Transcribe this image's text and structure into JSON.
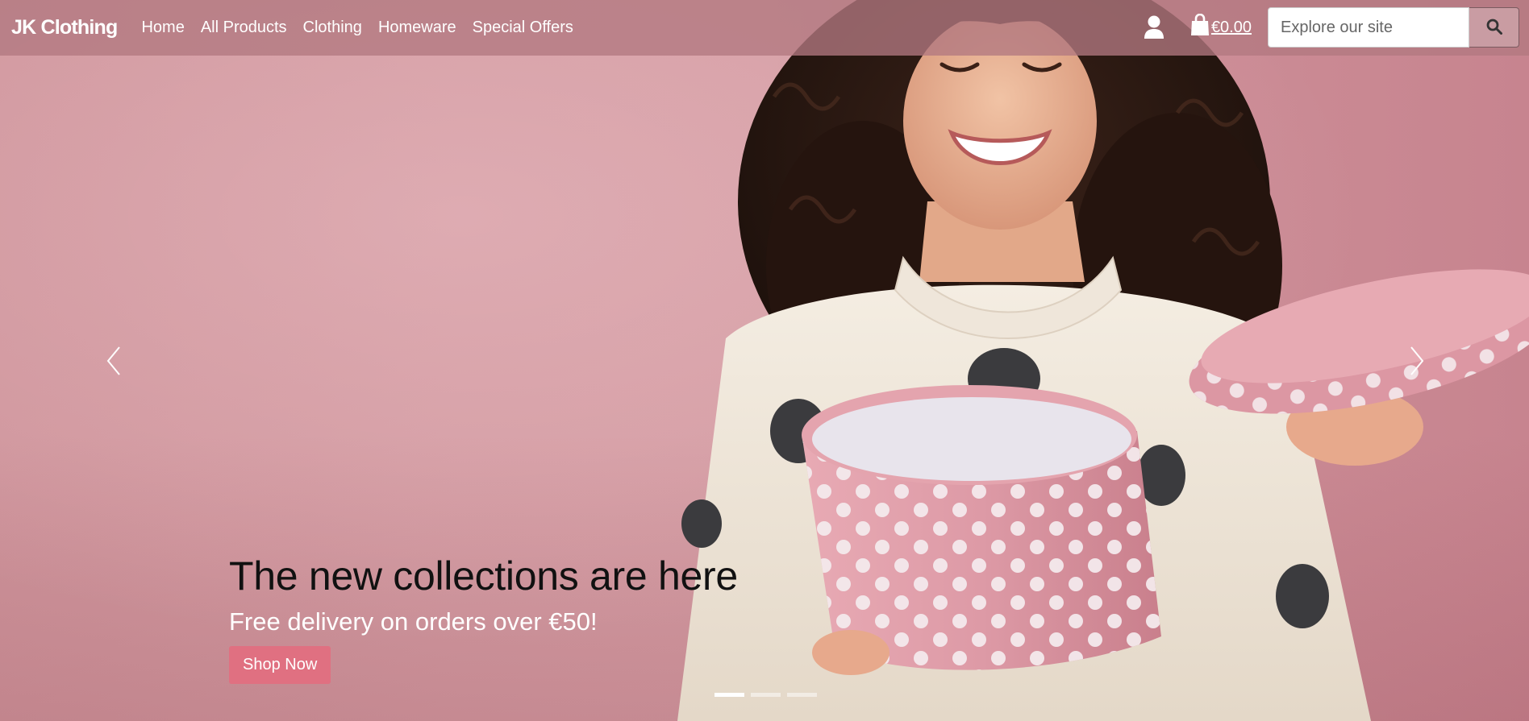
{
  "navbar": {
    "brand": "JK Clothing",
    "links": [
      "Home",
      "All Products",
      "Clothing",
      "Homeware",
      "Special Offers"
    ],
    "cart_total": "€0.00",
    "search_placeholder": "Explore our site"
  },
  "hero": {
    "heading": "The new collections are here",
    "subheading": "Free delivery on orders over €50!",
    "cta_label": "Shop Now",
    "slide_count": 3,
    "active_slide": 1
  },
  "colors": {
    "navbar_bg": "#b27880",
    "hero_bg": "#d49ca3",
    "cta_bg": "#e07081"
  },
  "icons": [
    "user-icon",
    "shopping-bag-icon",
    "search-icon",
    "chevron-left-icon",
    "chevron-right-icon"
  ]
}
